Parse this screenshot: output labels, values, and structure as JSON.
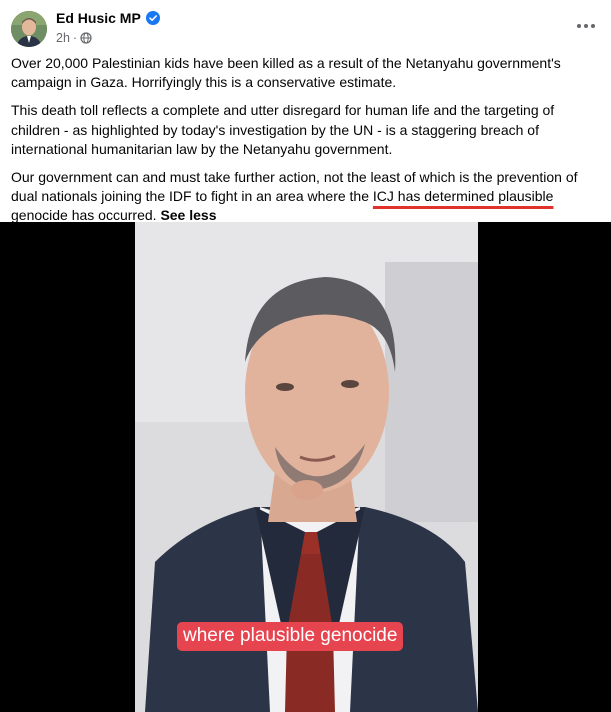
{
  "post": {
    "author": "Ed Husic MP",
    "verified_icon": "verified-badge-icon",
    "time": "2h",
    "separator": "·",
    "audience_icon": "globe-icon",
    "more_icon": "more-options-icon",
    "paragraphs": [
      "Over 20,000 Palestinian kids have been killed as a result of the Netanyahu government's campaign in Gaza. Horrifyingly this is a conservative estimate.",
      "This death toll reflects a complete and utter disregard for human life and the targeting of children - as highlighted by today's investigation by the UN - is a staggering breach of international humanitarian law by the Netanyahu government."
    ],
    "paragraph3": {
      "before": "Our government can and must take further action, not the least of which is the prevention of dual nationals joining the IDF to fight in an area where the ",
      "highlighted": "ICJ has determined plausible genocide has occurred",
      "after": ". ",
      "see_less": "See less"
    }
  },
  "video": {
    "caption": "where plausible genocide"
  },
  "colors": {
    "underline": "#e0312b",
    "caption_bg": "#e64550",
    "verified": "#1877f2",
    "meta_text": "#65676b"
  }
}
